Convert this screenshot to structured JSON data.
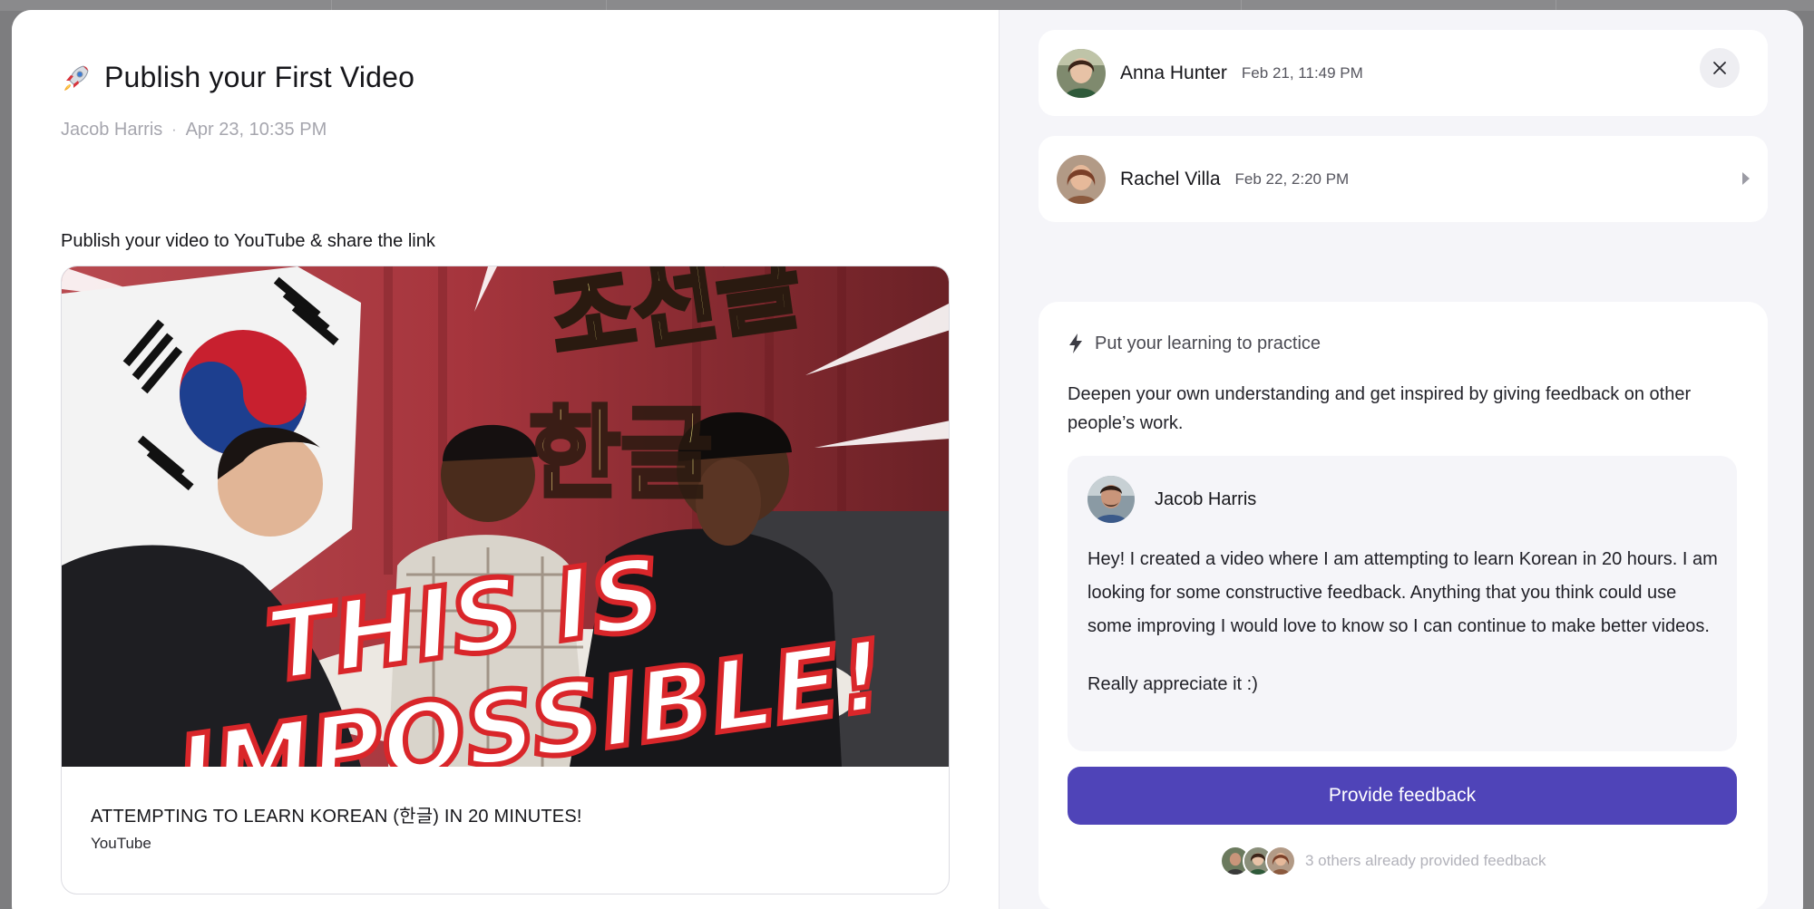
{
  "task": {
    "title": "Publish your First Video",
    "author": "Jacob Harris",
    "separator": "·",
    "date": "Apr 23, 10:35 PM",
    "instruction": "Publish your video to YouTube & share the link",
    "icon": "rocket-icon"
  },
  "video": {
    "title": "ATTEMPTING TO LEARN KOREAN (한글) IN 20 MINUTES!",
    "source": "YouTube",
    "thumbnail_text": {
      "korean_top": "조선글",
      "korean_bottom": "한글",
      "line1": "THIS IS",
      "line2": "IMPOSSIBLE!"
    }
  },
  "submissions": [
    {
      "name": "Anna Hunter",
      "date": "Feb 21, 11:49 PM"
    },
    {
      "name": "Rachel Villa",
      "date": "Feb 22, 2:20 PM"
    }
  ],
  "practice": {
    "icon": "lightning-icon",
    "heading": "Put your learning to practice",
    "description": "Deepen your own understanding and get inspired by giving feedback on other people’s work.",
    "post": {
      "author": "Jacob Harris",
      "paragraphs": [
        "Hey! I created a video where I am attempting to learn Korean in 20 hours. I am looking for some constructive feedback. Anything that you think could use some improving I would love to know so I can continue to make better videos.",
        "Really appreciate it :)"
      ]
    },
    "cta_label": "Provide feedback",
    "others_text": "3 others already provided feedback"
  },
  "colors": {
    "accent": "#4f44b8",
    "backdrop": "#7d7d7f",
    "panel": "#f5f5f9"
  }
}
